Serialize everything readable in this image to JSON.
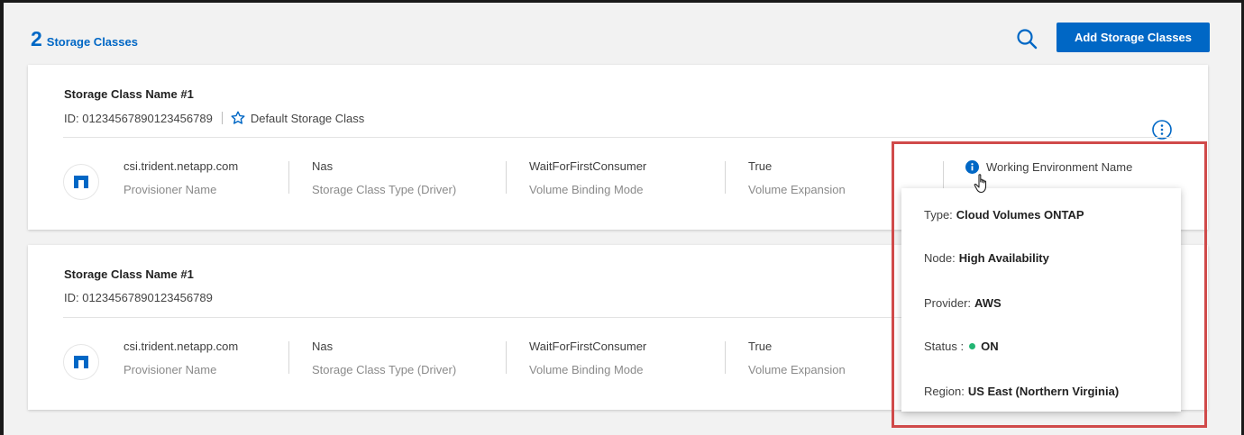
{
  "header": {
    "count": "2",
    "title": "Storage Classes",
    "add_button": "Add Storage Classes"
  },
  "colors": {
    "accent": "#0067c5",
    "highlight": "#d04a4a",
    "status_on": "#22b573"
  },
  "cards": [
    {
      "name": "Storage Class Name #1",
      "id": "ID: 01234567890123456789",
      "default_label": "Default Storage Class",
      "provisioner": "csi.trident.netapp.com",
      "provisioner_label": "Provisioner Name",
      "type": "Nas",
      "type_label": "Storage Class Type (Driver)",
      "binding": "WaitForFirstConsumer",
      "binding_label": "Volume Binding Mode",
      "expansion": "True",
      "expansion_label": "Volume Expansion",
      "working_env": "Working Environment Name"
    },
    {
      "name": "Storage Class Name #1",
      "id": "ID: 01234567890123456789",
      "provisioner": "csi.trident.netapp.com",
      "provisioner_label": "Provisioner Name",
      "type": "Nas",
      "type_label": "Storage Class Type (Driver)",
      "binding": "WaitForFirstConsumer",
      "binding_label": "Volume Binding Mode",
      "expansion": "True",
      "expansion_label": "Volume Expansion"
    }
  ],
  "popup": {
    "type_label": "Type:",
    "type_value": "Cloud Volumes ONTAP",
    "node_label": "Node:",
    "node_value": "High Availability",
    "provider_label": "Provider:",
    "provider_value": "AWS",
    "status_label": "Status :",
    "status_value": "ON",
    "region_label": "Region:",
    "region_value": "US East (Northern Virginia)"
  },
  "icons": {
    "search": "search-icon",
    "kebab": "info-circle-icon",
    "star": "star-icon",
    "netapp": "netapp-logo-icon",
    "info": "info-icon",
    "cursor": "hand-pointer-icon"
  }
}
